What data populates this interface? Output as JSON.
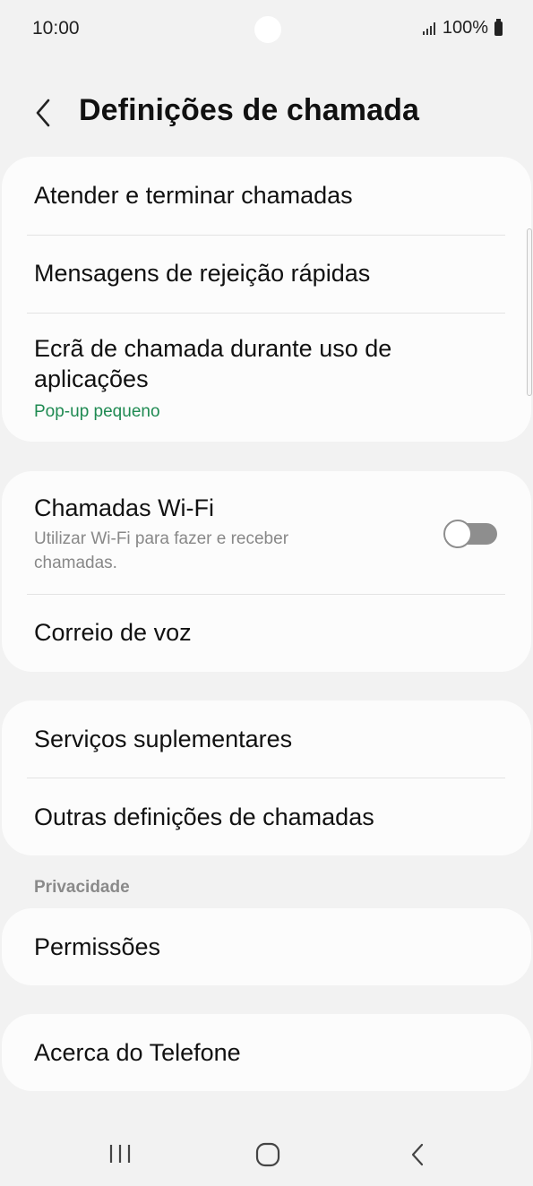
{
  "status_bar": {
    "time": "10:00",
    "battery": "100%"
  },
  "header": {
    "title": "Definições de chamada"
  },
  "groups": [
    {
      "items": [
        {
          "title": "Atender e terminar chamadas"
        },
        {
          "title": "Mensagens de rejeição rápidas"
        },
        {
          "title": "Ecrã de chamada durante uso de aplicações",
          "subtitle": "Pop-up pequeno"
        }
      ]
    },
    {
      "items": [
        {
          "title": "Chamadas Wi-Fi",
          "subtitle": "Utilizar Wi-Fi para fazer e receber chamadas.",
          "toggle": false
        },
        {
          "title": "Correio de voz"
        }
      ]
    },
    {
      "items": [
        {
          "title": "Serviços suplementares"
        },
        {
          "title": "Outras definições de chamadas"
        }
      ]
    },
    {
      "section_label": "Privacidade",
      "items": [
        {
          "title": "Permissões"
        }
      ]
    },
    {
      "items": [
        {
          "title": "Acerca do Telefone"
        }
      ]
    }
  ],
  "colors": {
    "accent_subtitle": "#1f8a52",
    "background": "#f2f2f2",
    "card": "#fcfcfc"
  },
  "icons": {
    "back": "chevron-left-icon",
    "nav_recents": "recents-icon",
    "nav_home": "home-icon",
    "nav_back": "nav-back-icon"
  }
}
